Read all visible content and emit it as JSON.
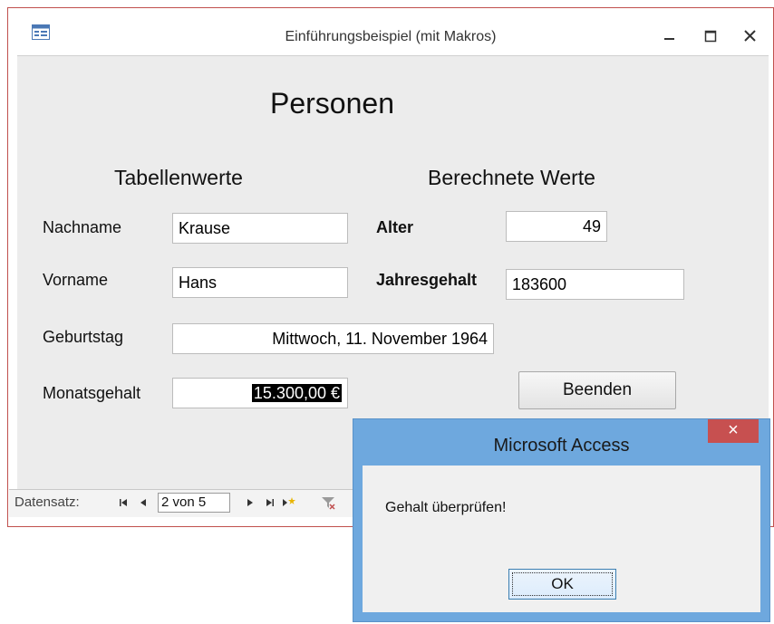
{
  "window": {
    "title": "Einführungsbeispiel (mit Makros)"
  },
  "form": {
    "title": "Personen",
    "section_table": "Tabellenwerte",
    "section_calc": "Berechnete Werte",
    "fields": {
      "nachname": {
        "label": "Nachname",
        "value": "Krause"
      },
      "vorname": {
        "label": "Vorname",
        "value": "Hans"
      },
      "geburtstag": {
        "label": "Geburtstag",
        "value": "Mittwoch, 11. November 1964"
      },
      "monatsgehalt": {
        "label": "Monatsgehalt",
        "value": "15.300,00 €"
      },
      "alter": {
        "label": "Alter",
        "value": "49"
      },
      "jahresgehalt": {
        "label": "Jahresgehalt",
        "value": "183600"
      }
    },
    "exit_button": "Beenden"
  },
  "navigation": {
    "label": "Datensatz:",
    "record": "2 von 5"
  },
  "dialog": {
    "title": "Microsoft Access",
    "close_symbol": "×",
    "message": "Gehalt überprüfen!",
    "ok_label": "OK"
  },
  "colors": {
    "window_border": "#c0504d",
    "dialog_frame": "#6ea8de",
    "dialog_close": "#c75050",
    "selection": "#000000"
  },
  "icons": [
    "form-icon",
    "minimize-icon",
    "maximize-icon",
    "close-icon",
    "first-record-icon",
    "previous-record-icon",
    "next-record-icon",
    "last-record-icon",
    "new-record-icon",
    "filter-icon"
  ]
}
